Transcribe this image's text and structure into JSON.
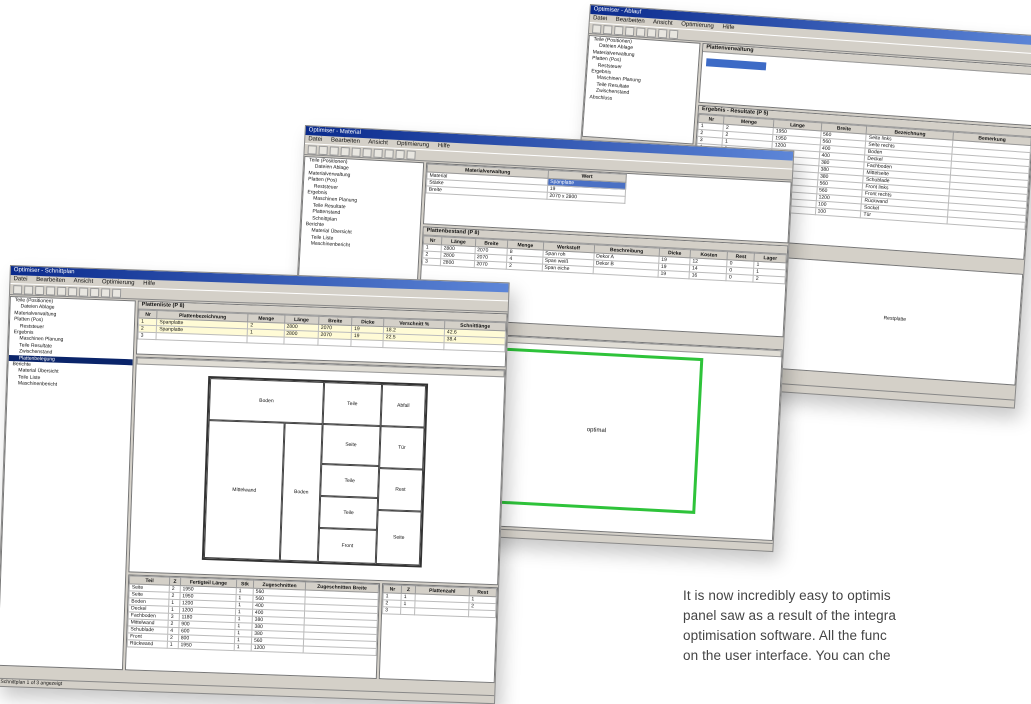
{
  "colors": {
    "accent_green": "#2ec33a",
    "selection": "#0a246a",
    "window_bg": "#d4d0c8"
  },
  "windows": {
    "back": {
      "title": "Optimiser - Ablauf",
      "menu": [
        "Datei",
        "Bearbeiten",
        "Ansicht",
        "Optimierung",
        "Hilfe"
      ],
      "tree": [
        "Teile (Positionen)",
        "Dateien Ablage",
        "Materialverwaltung",
        "Platten (Pos)",
        "Reststeuer",
        "Ergebnis",
        "Maschinen Planung",
        "Teile Resultate",
        "Zwischenstand",
        "Abschluss"
      ],
      "header_title": "Plattenverwaltung",
      "list_title": "Ergebnis - Resultate (P 5)",
      "list_columns": [
        "Nr",
        "Menge",
        "Länge",
        "Breite",
        "Bezeichnung",
        "Bemerkung"
      ],
      "rows": [
        [
          "1",
          "2",
          "1950",
          "560",
          "Seite links",
          ""
        ],
        [
          "2",
          "2",
          "1950",
          "560",
          "Seite rechts",
          ""
        ],
        [
          "3",
          "1",
          "1200",
          "400",
          "Boden",
          ""
        ],
        [
          "4",
          "1",
          "1200",
          "400",
          "Deckel",
          ""
        ],
        [
          "5",
          "3",
          "1180",
          "380",
          "Fachboden",
          ""
        ],
        [
          "6",
          "2",
          "900",
          "380",
          "Mittelseite",
          ""
        ],
        [
          "7",
          "4",
          "600",
          "380",
          "Schublade",
          ""
        ],
        [
          "8",
          "2",
          "800",
          "560",
          "Front links",
          ""
        ],
        [
          "9",
          "2",
          "800",
          "560",
          "Front rechts",
          ""
        ],
        [
          "10",
          "1",
          "1950",
          "1200",
          "Rückwand",
          ""
        ],
        [
          "11",
          "1",
          "1200",
          "100",
          "Sockel",
          ""
        ],
        [
          "12",
          "1",
          "900",
          "100",
          "Tür",
          ""
        ]
      ],
      "canvas_label": "Restplatte",
      "status": "Bereit"
    },
    "mid": {
      "title": "Optimiser - Material",
      "menu": [
        "Datei",
        "Bearbeiten",
        "Ansicht",
        "Optimierung",
        "Hilfe"
      ],
      "tree": [
        "Teile (Positionen)",
        "Dateien Ablage",
        "Materialverwaltung",
        "Platten (Pos)",
        "Reststeuer",
        "Ergebnis",
        "Maschinen Planung",
        "Teile Resultate",
        "Plattenstand",
        "Schnittplan",
        "Berichte",
        "Material Übersicht",
        "Teile Liste",
        "Maschinenbericht"
      ],
      "header_columns": [
        "Materialverwaltung",
        "Wert"
      ],
      "header_rows": [
        [
          "Material",
          "Spanplatte"
        ],
        [
          "Stärke",
          "19"
        ],
        [
          "Breite",
          "2070 x 2800"
        ]
      ],
      "list_title": "Plattenbestand (P 8)",
      "list_columns": [
        "Nr",
        "Länge",
        "Breite",
        "Menge",
        "Werkstoff",
        "Beschreibung",
        "Dicke",
        "Kosten",
        "Rest",
        "Lager"
      ],
      "rows": [
        [
          "1",
          "2800",
          "2070",
          "8",
          "Span roh",
          "Dekor A",
          "19",
          "12",
          "0",
          "1"
        ],
        [
          "2",
          "2800",
          "2070",
          "4",
          "Span weiß",
          "Dekor B",
          "19",
          "14",
          "0",
          "1"
        ],
        [
          "3",
          "2800",
          "2070",
          "2",
          "Span eiche",
          "",
          "19",
          "16",
          "0",
          "2"
        ]
      ],
      "canvas_label": "optimal",
      "status": "Bereit"
    },
    "front": {
      "title": "Optimiser - Schnittplan",
      "menu": [
        "Datei",
        "Bearbeiten",
        "Ansicht",
        "Optimierung",
        "Hilfe"
      ],
      "tree": [
        "Teile (Positionen)",
        "Dateien Ablage",
        "Materialverwaltung",
        "Platten (Pos)",
        "Reststeuer",
        "Ergebnis",
        "Maschinen Planung",
        "Teile Resultate",
        "Zwischenstand",
        "Plattenbelegung",
        "Berichte",
        "Material Übersicht",
        "Teile Liste",
        "Maschinenbericht"
      ],
      "tree_selected": "Plattenbelegung",
      "grid_title": "Plattenliste (P 8)",
      "grid_columns": [
        "Nr",
        "Plattenbezeichnung",
        "Menge",
        "Länge",
        "Breite",
        "Dicke",
        "Verschnitt %",
        "Schnittlänge"
      ],
      "grid_rows": [
        [
          "1",
          "Spanplatte",
          "2",
          "2800",
          "2070",
          "19",
          "18.2",
          "42.6"
        ],
        [
          "2",
          "Spanplatte",
          "1",
          "2800",
          "2070",
          "19",
          "22.5",
          "38.4"
        ],
        [
          "3",
          "",
          "",
          "",
          "",
          "",
          "",
          ""
        ]
      ],
      "rooms": [
        "Boden",
        "Teile",
        "Abfall",
        "Seite",
        "Mittelwand",
        "Boden",
        "Teile",
        "Tür",
        "Teile",
        "Rest",
        "Front",
        "Seite"
      ],
      "parts_columns": [
        "Teil",
        "Z",
        "Fertigteil Länge",
        "Stk",
        "Zugeschnitten",
        "Zugeschnitten Breite"
      ],
      "parts_rows": [
        [
          "Seite",
          "2",
          "1950",
          "1",
          "560",
          ""
        ],
        [
          "Seite",
          "2",
          "1950",
          "1",
          "560",
          ""
        ],
        [
          "Boden",
          "1",
          "1200",
          "1",
          "400",
          ""
        ],
        [
          "Deckel",
          "1",
          "1200",
          "1",
          "400",
          ""
        ],
        [
          "Fachboden",
          "3",
          "1180",
          "1",
          "380",
          ""
        ],
        [
          "Mittelwand",
          "2",
          "900",
          "1",
          "380",
          ""
        ],
        [
          "Schublade",
          "4",
          "600",
          "1",
          "380",
          ""
        ],
        [
          "Front",
          "2",
          "800",
          "1",
          "560",
          ""
        ],
        [
          "Rückwand",
          "1",
          "1950",
          "1",
          "1200",
          ""
        ]
      ],
      "right_columns": [
        "Nr",
        "Z",
        "Plattenzahl",
        "Rest"
      ],
      "right_rows": [
        [
          "1",
          "1",
          "",
          "1"
        ],
        [
          "2",
          "1",
          "",
          "2"
        ],
        [
          "3",
          "",
          "",
          ""
        ]
      ],
      "status": "Schnittplan 1 of 3 angezeigt"
    }
  },
  "caption": {
    "line1": "It is now incredibly easy to optimis",
    "line2": "panel saw as a result of the integra",
    "line3": "optimisation software. All the func",
    "line4": "on the user interface. You can che"
  }
}
